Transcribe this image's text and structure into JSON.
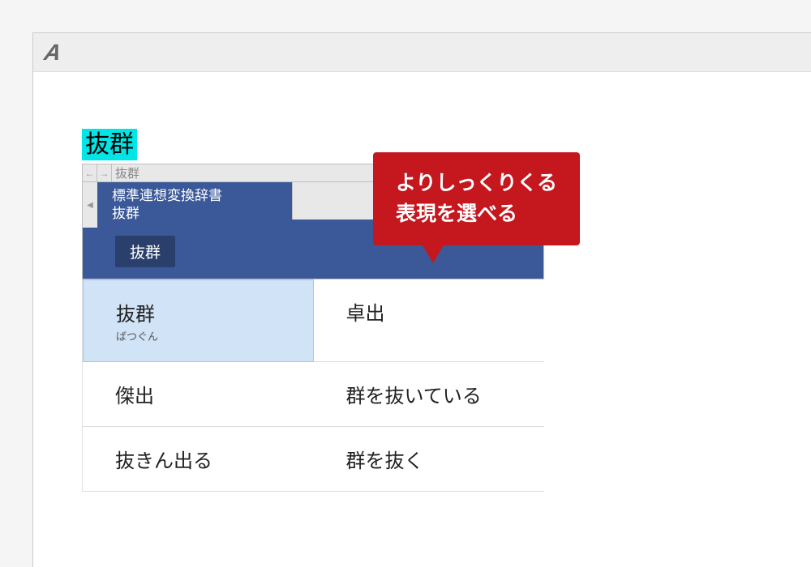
{
  "input": {
    "selected_text": "抜群"
  },
  "ime": {
    "nav_text": "抜群",
    "dictionary_title": "標準連想変換辞書",
    "dictionary_word": "抜群",
    "active_tab": "抜群",
    "candidates": [
      {
        "word": "抜群",
        "reading": "ばつぐん"
      },
      {
        "word": "卓出",
        "reading": ""
      },
      {
        "word": "傑出",
        "reading": ""
      },
      {
        "word": "群を抜いている",
        "reading": ""
      },
      {
        "word": "抜きん出る",
        "reading": ""
      },
      {
        "word": "群を抜く",
        "reading": ""
      }
    ]
  },
  "callout": {
    "line1": "よりしっくりくる",
    "line2": "表現を選べる"
  }
}
